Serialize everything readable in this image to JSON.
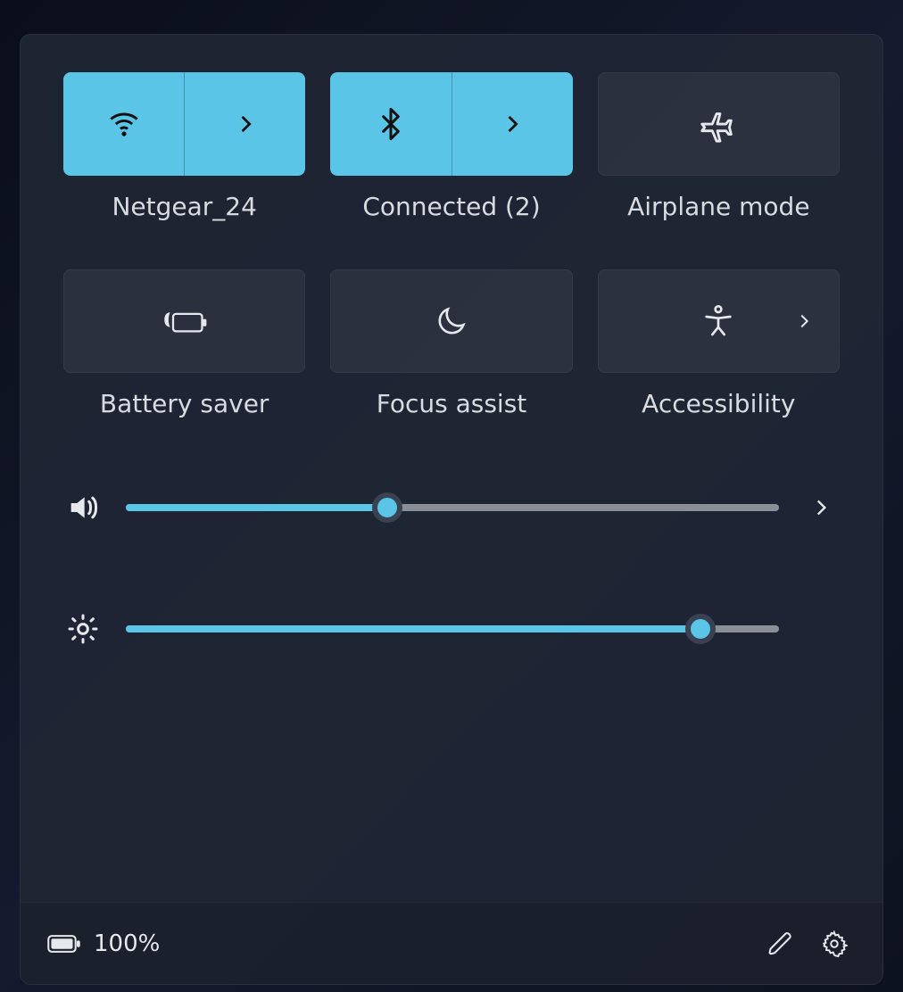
{
  "colors": {
    "accent": "#5bc5e8"
  },
  "tiles": [
    {
      "id": "wifi",
      "label": "Netgear_24",
      "active": true,
      "split": true,
      "icon": "wifi-icon"
    },
    {
      "id": "bluetooth",
      "label": "Connected (2)",
      "active": true,
      "split": true,
      "icon": "bluetooth-icon"
    },
    {
      "id": "airplane",
      "label": "Airplane mode",
      "active": false,
      "split": false,
      "icon": "airplane-icon"
    },
    {
      "id": "battery-saver",
      "label": "Battery saver",
      "active": false,
      "split": false,
      "icon": "battery-saver-icon"
    },
    {
      "id": "focus-assist",
      "label": "Focus assist",
      "active": false,
      "split": false,
      "icon": "moon-icon"
    },
    {
      "id": "accessibility",
      "label": "Accessibility",
      "active": false,
      "split": false,
      "icon": "accessibility-icon",
      "has_chevron": true
    }
  ],
  "sliders": {
    "volume": {
      "percent": 40,
      "has_expand": true
    },
    "brightness": {
      "percent": 88,
      "has_expand": false
    }
  },
  "footer": {
    "battery_percent_label": "100%"
  }
}
